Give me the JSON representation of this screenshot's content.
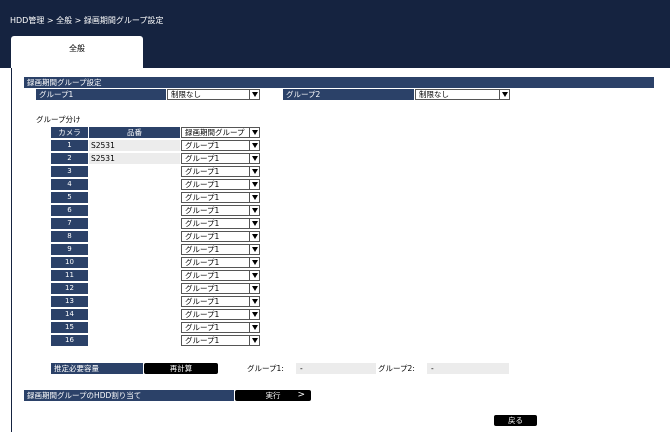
{
  "header": {
    "breadcrumb": "HDD管理 > 全般 > 録画期間グループ設定"
  },
  "tabs": [
    {
      "label": "全般"
    }
  ],
  "settings": {
    "title": "録画期間グループ設定",
    "group1_label": "グループ1",
    "group1_value": "制限なし",
    "group2_label": "グループ2",
    "group2_value": "制限なし"
  },
  "grouping": {
    "title": "グループ分け",
    "col_camera": "カメラ",
    "col_model": "品番",
    "col_group": "録画期間グループ",
    "rows": [
      {
        "num": "1",
        "model": "S2531",
        "group": "グループ1"
      },
      {
        "num": "2",
        "model": "S2531",
        "group": "グループ1"
      },
      {
        "num": "3",
        "model": "",
        "group": "グループ1"
      },
      {
        "num": "4",
        "model": "",
        "group": "グループ1"
      },
      {
        "num": "5",
        "model": "",
        "group": "グループ1"
      },
      {
        "num": "6",
        "model": "",
        "group": "グループ1"
      },
      {
        "num": "7",
        "model": "",
        "group": "グループ1"
      },
      {
        "num": "8",
        "model": "",
        "group": "グループ1"
      },
      {
        "num": "9",
        "model": "",
        "group": "グループ1"
      },
      {
        "num": "10",
        "model": "",
        "group": "グループ1"
      },
      {
        "num": "11",
        "model": "",
        "group": "グループ1"
      },
      {
        "num": "12",
        "model": "",
        "group": "グループ1"
      },
      {
        "num": "13",
        "model": "",
        "group": "グループ1"
      },
      {
        "num": "14",
        "model": "",
        "group": "グループ1"
      },
      {
        "num": "15",
        "model": "",
        "group": "グループ1"
      },
      {
        "num": "16",
        "model": "",
        "group": "グループ1"
      }
    ]
  },
  "capacity": {
    "label": "推定必要容量",
    "recalc": "再計算",
    "group1_label": "グループ1:",
    "group1_value": "-",
    "group2_label": "グループ2:",
    "group2_value": "-"
  },
  "assign": {
    "label": "録画期間グループのHDD割り当て",
    "execute": "実行"
  },
  "footer": {
    "back": "戻る"
  }
}
